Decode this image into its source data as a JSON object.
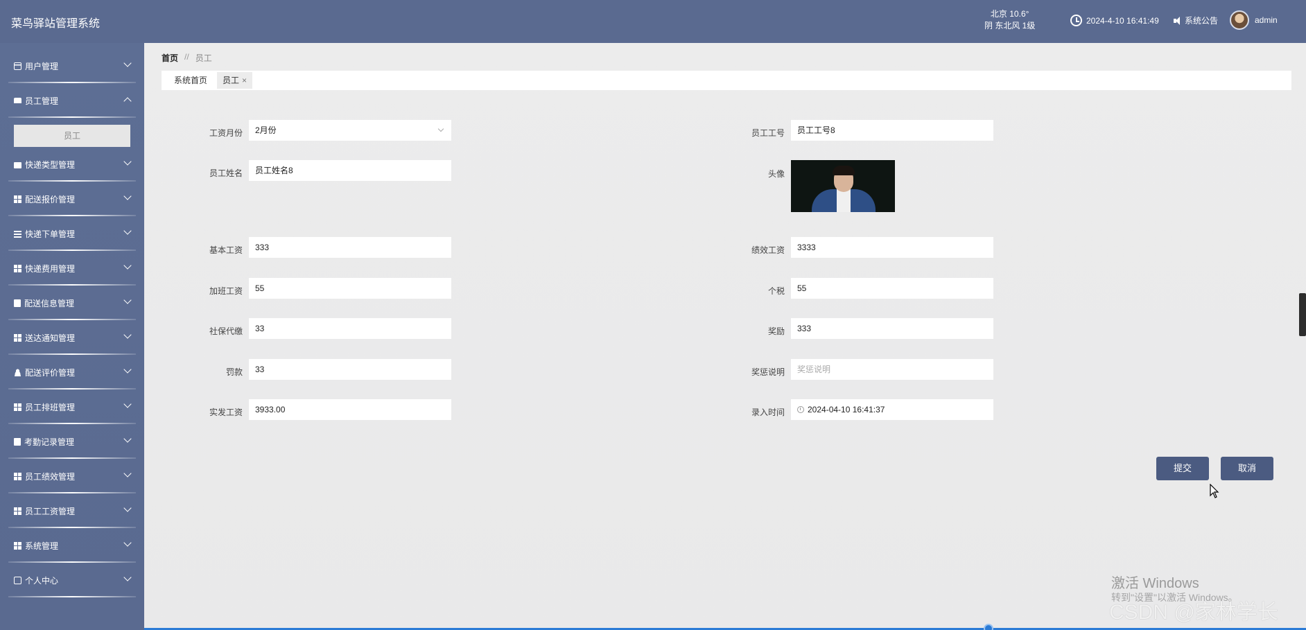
{
  "app": {
    "title": "菜鸟驿站管理系统"
  },
  "header": {
    "weather_line1": "北京  10.6°",
    "weather_line2": "阴  东北风  1级",
    "datetime": "2024-4-10 16:41:49",
    "notice_label": "系统公告",
    "username": "admin"
  },
  "sidebar": {
    "items": [
      {
        "label": "用户管理",
        "icon": "user-card-icon"
      },
      {
        "label": "员工管理",
        "icon": "pin-icon",
        "expanded": true
      },
      {
        "label": "快递类型管理",
        "icon": "bag-icon"
      },
      {
        "label": "配送报价管理",
        "icon": "grid-icon"
      },
      {
        "label": "快递下单管理",
        "icon": "list-icon"
      },
      {
        "label": "快递费用管理",
        "icon": "grid-icon"
      },
      {
        "label": "配送信息管理",
        "icon": "clipboard-icon"
      },
      {
        "label": "送达通知管理",
        "icon": "grid-icon"
      },
      {
        "label": "配送评价管理",
        "icon": "person-icon"
      },
      {
        "label": "员工排班管理",
        "icon": "grid-icon"
      },
      {
        "label": "考勤记录管理",
        "icon": "clipboard-icon"
      },
      {
        "label": "员工绩效管理",
        "icon": "grid-icon"
      },
      {
        "label": "员工工资管理",
        "icon": "grid-icon"
      },
      {
        "label": "系统管理",
        "icon": "grid-icon"
      },
      {
        "label": "个人中心",
        "icon": "card-icon"
      }
    ],
    "submenu_label": "员工"
  },
  "breadcrumb": {
    "home": "首页",
    "sep": "//",
    "current": "员工"
  },
  "tabs": [
    {
      "label": "系统首页"
    },
    {
      "label": "员工",
      "close": "×"
    }
  ],
  "form": {
    "salary_month": {
      "label": "工资月份",
      "value": "2月份"
    },
    "employee_no": {
      "label": "员工工号",
      "value": "员工工号8"
    },
    "employee_name": {
      "label": "员工姓名",
      "value": "员工姓名8"
    },
    "avatar": {
      "label": "头像"
    },
    "base_salary": {
      "label": "基本工资",
      "value": "333"
    },
    "performance_salary": {
      "label": "绩效工资",
      "value": "3333"
    },
    "overtime_pay": {
      "label": "加班工资",
      "value": "55"
    },
    "income_tax": {
      "label": "个税",
      "value": "55"
    },
    "social_security": {
      "label": "社保代缴",
      "value": "33"
    },
    "bonus": {
      "label": "奖励",
      "value": "333"
    },
    "fine": {
      "label": "罚款",
      "value": "33"
    },
    "reward_note": {
      "label": "奖惩说明",
      "placeholder": "奖惩说明"
    },
    "net_pay": {
      "label": "实发工资",
      "value": "3933.00"
    },
    "entry_time": {
      "label": "录入时间",
      "value": "2024-04-10 16:41:37"
    }
  },
  "buttons": {
    "submit": "提交",
    "cancel": "取消"
  },
  "watermark": {
    "activate_title": "激活 Windows",
    "activate_sub": "转到\"设置\"以激活 Windows。",
    "csdn": "CSDN @家林学长"
  },
  "colors": {
    "primary": "#5a6a90",
    "button": "#4b5b81",
    "background": "#ececec"
  }
}
